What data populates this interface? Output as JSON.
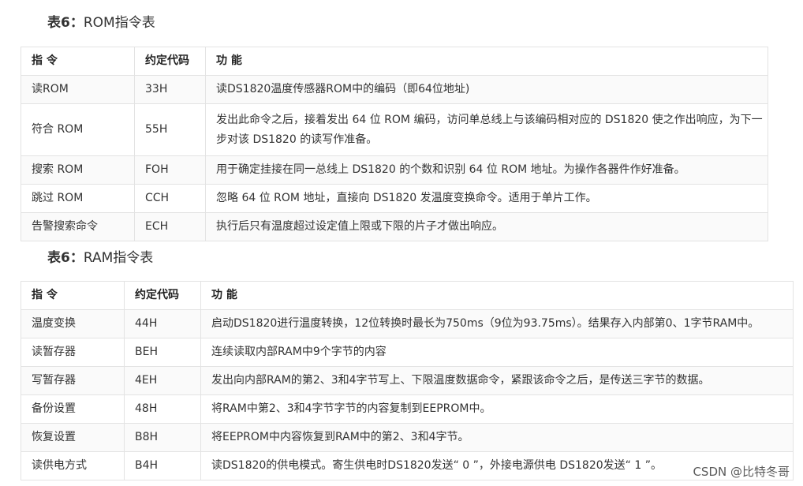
{
  "rom_section": {
    "caption_lead": "表6：",
    "caption_rest": "ROM指令表",
    "headers": [
      "指 令",
      "约定代码",
      "功 能"
    ],
    "rows": [
      [
        "读ROM",
        "33H",
        "读DS1820温度传感器ROM中的编码（即64位地址)"
      ],
      [
        "符合 ROM",
        "55H",
        "发出此命令之后，接着发出 64 位 ROM 编码，访问单总线上与该编码相对应的 DS1820 使之作出响应，为下一步对该 DS1820 的读写作准备。"
      ],
      [
        "搜索 ROM",
        "FOH",
        "用于确定挂接在同一总线上 DS1820 的个数和识别 64 位 ROM 地址。为操作各器件作好准备。"
      ],
      [
        "跳过 ROM",
        "CCH",
        "忽略 64 位 ROM 地址，直接向 DS1820 发温度变换命令。适用于单片工作。"
      ],
      [
        "告警搜索命令",
        "ECH",
        "执行后只有温度超过设定值上限或下限的片子才做出响应。"
      ]
    ]
  },
  "ram_section": {
    "caption_lead": "表6：",
    "caption_rest": "RAM指令表",
    "headers": [
      "指 令",
      "约定代码",
      "功 能"
    ],
    "rows": [
      [
        "温度变换",
        "44H",
        "启动DS1820进行温度转换，12位转换时最长为750ms（9位为93.75ms）。结果存入内部第0、1字节RAM中。"
      ],
      [
        "读暂存器",
        "BEH",
        "连续读取内部RAM中9个字节的内容"
      ],
      [
        "写暂存器",
        "4EH",
        "发出向内部RAM的第2、3和4字节写上、下限温度数据命令，紧跟该命令之后，是传送三字节的数据。"
      ],
      [
        "备份设置",
        "48H",
        "将RAM中第2、3和4字节字节的内容复制到EEPROM中。"
      ],
      [
        "恢复设置",
        "B8H",
        "将EEPROM中内容恢复到RAM中的第2、3和4字节。"
      ],
      [
        "读供电方式",
        "B4H",
        "读DS1820的供电模式。寄生供电时DS1820发送“ 0 ”，外接电源供电 DS1820发送“ 1 ”。"
      ]
    ]
  },
  "watermark": "CSDN @比特冬哥"
}
